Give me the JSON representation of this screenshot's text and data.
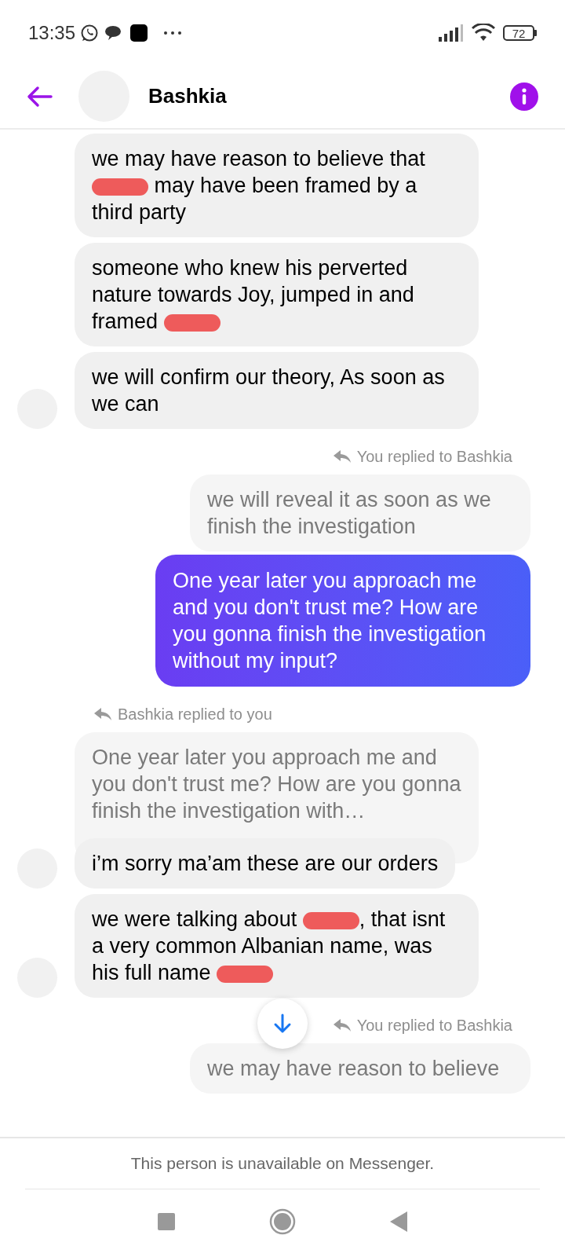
{
  "status_bar": {
    "time": "13:35",
    "battery": "72"
  },
  "header": {
    "title": "Bashkia"
  },
  "messages": [
    {
      "kind": "incoming",
      "avatar": false,
      "parts": [
        {
          "kind": "text",
          "text": "we may have reason to believe that "
        },
        {
          "kind": "redaction"
        },
        {
          "kind": "text",
          "text": " may have been framed by a third party"
        }
      ]
    },
    {
      "kind": "incoming",
      "avatar": false,
      "parts": [
        {
          "kind": "text",
          "text": "someone who knew his perverted nature towards Joy, jumped in and framed "
        },
        {
          "kind": "redaction"
        }
      ]
    },
    {
      "kind": "incoming",
      "avatar": true,
      "parts": [
        {
          "kind": "text",
          "text": "we will confirm our theory, As soon as we can"
        }
      ]
    },
    {
      "kind": "sent_reply_label",
      "text": "You replied to Bashkia"
    },
    {
      "kind": "sent_quote",
      "text": "we will reveal it as soon as we finish the investigation"
    },
    {
      "kind": "outgoing",
      "parts": [
        {
          "kind": "text",
          "text": "One year later you approach me and you don't trust me? How are you gonna finish the investigation without my input?"
        }
      ]
    },
    {
      "kind": "received_reply_label",
      "text": "Bashkia replied to you"
    },
    {
      "kind": "received_quote",
      "text": "One year later you approach me and you don't trust me? How are you gonna finish the investigation with…"
    },
    {
      "kind": "incoming",
      "avatar": true,
      "parts": [
        {
          "kind": "text",
          "text": "i’m sorry ma’am these are our orders"
        }
      ]
    },
    {
      "kind": "incoming",
      "avatar": true,
      "parts": [
        {
          "kind": "text",
          "text": "we were talking about "
        },
        {
          "kind": "redaction"
        },
        {
          "kind": "text",
          "text": ", that isnt a very common Albanian name, was his full name "
        },
        {
          "kind": "redaction"
        }
      ]
    },
    {
      "kind": "sent_reply_label",
      "text": "You replied to Bashkia"
    },
    {
      "kind": "sent_quote",
      "text": "we may have reason to believe"
    }
  ],
  "footer": {
    "notice": "This person is unavailable on Messenger."
  }
}
